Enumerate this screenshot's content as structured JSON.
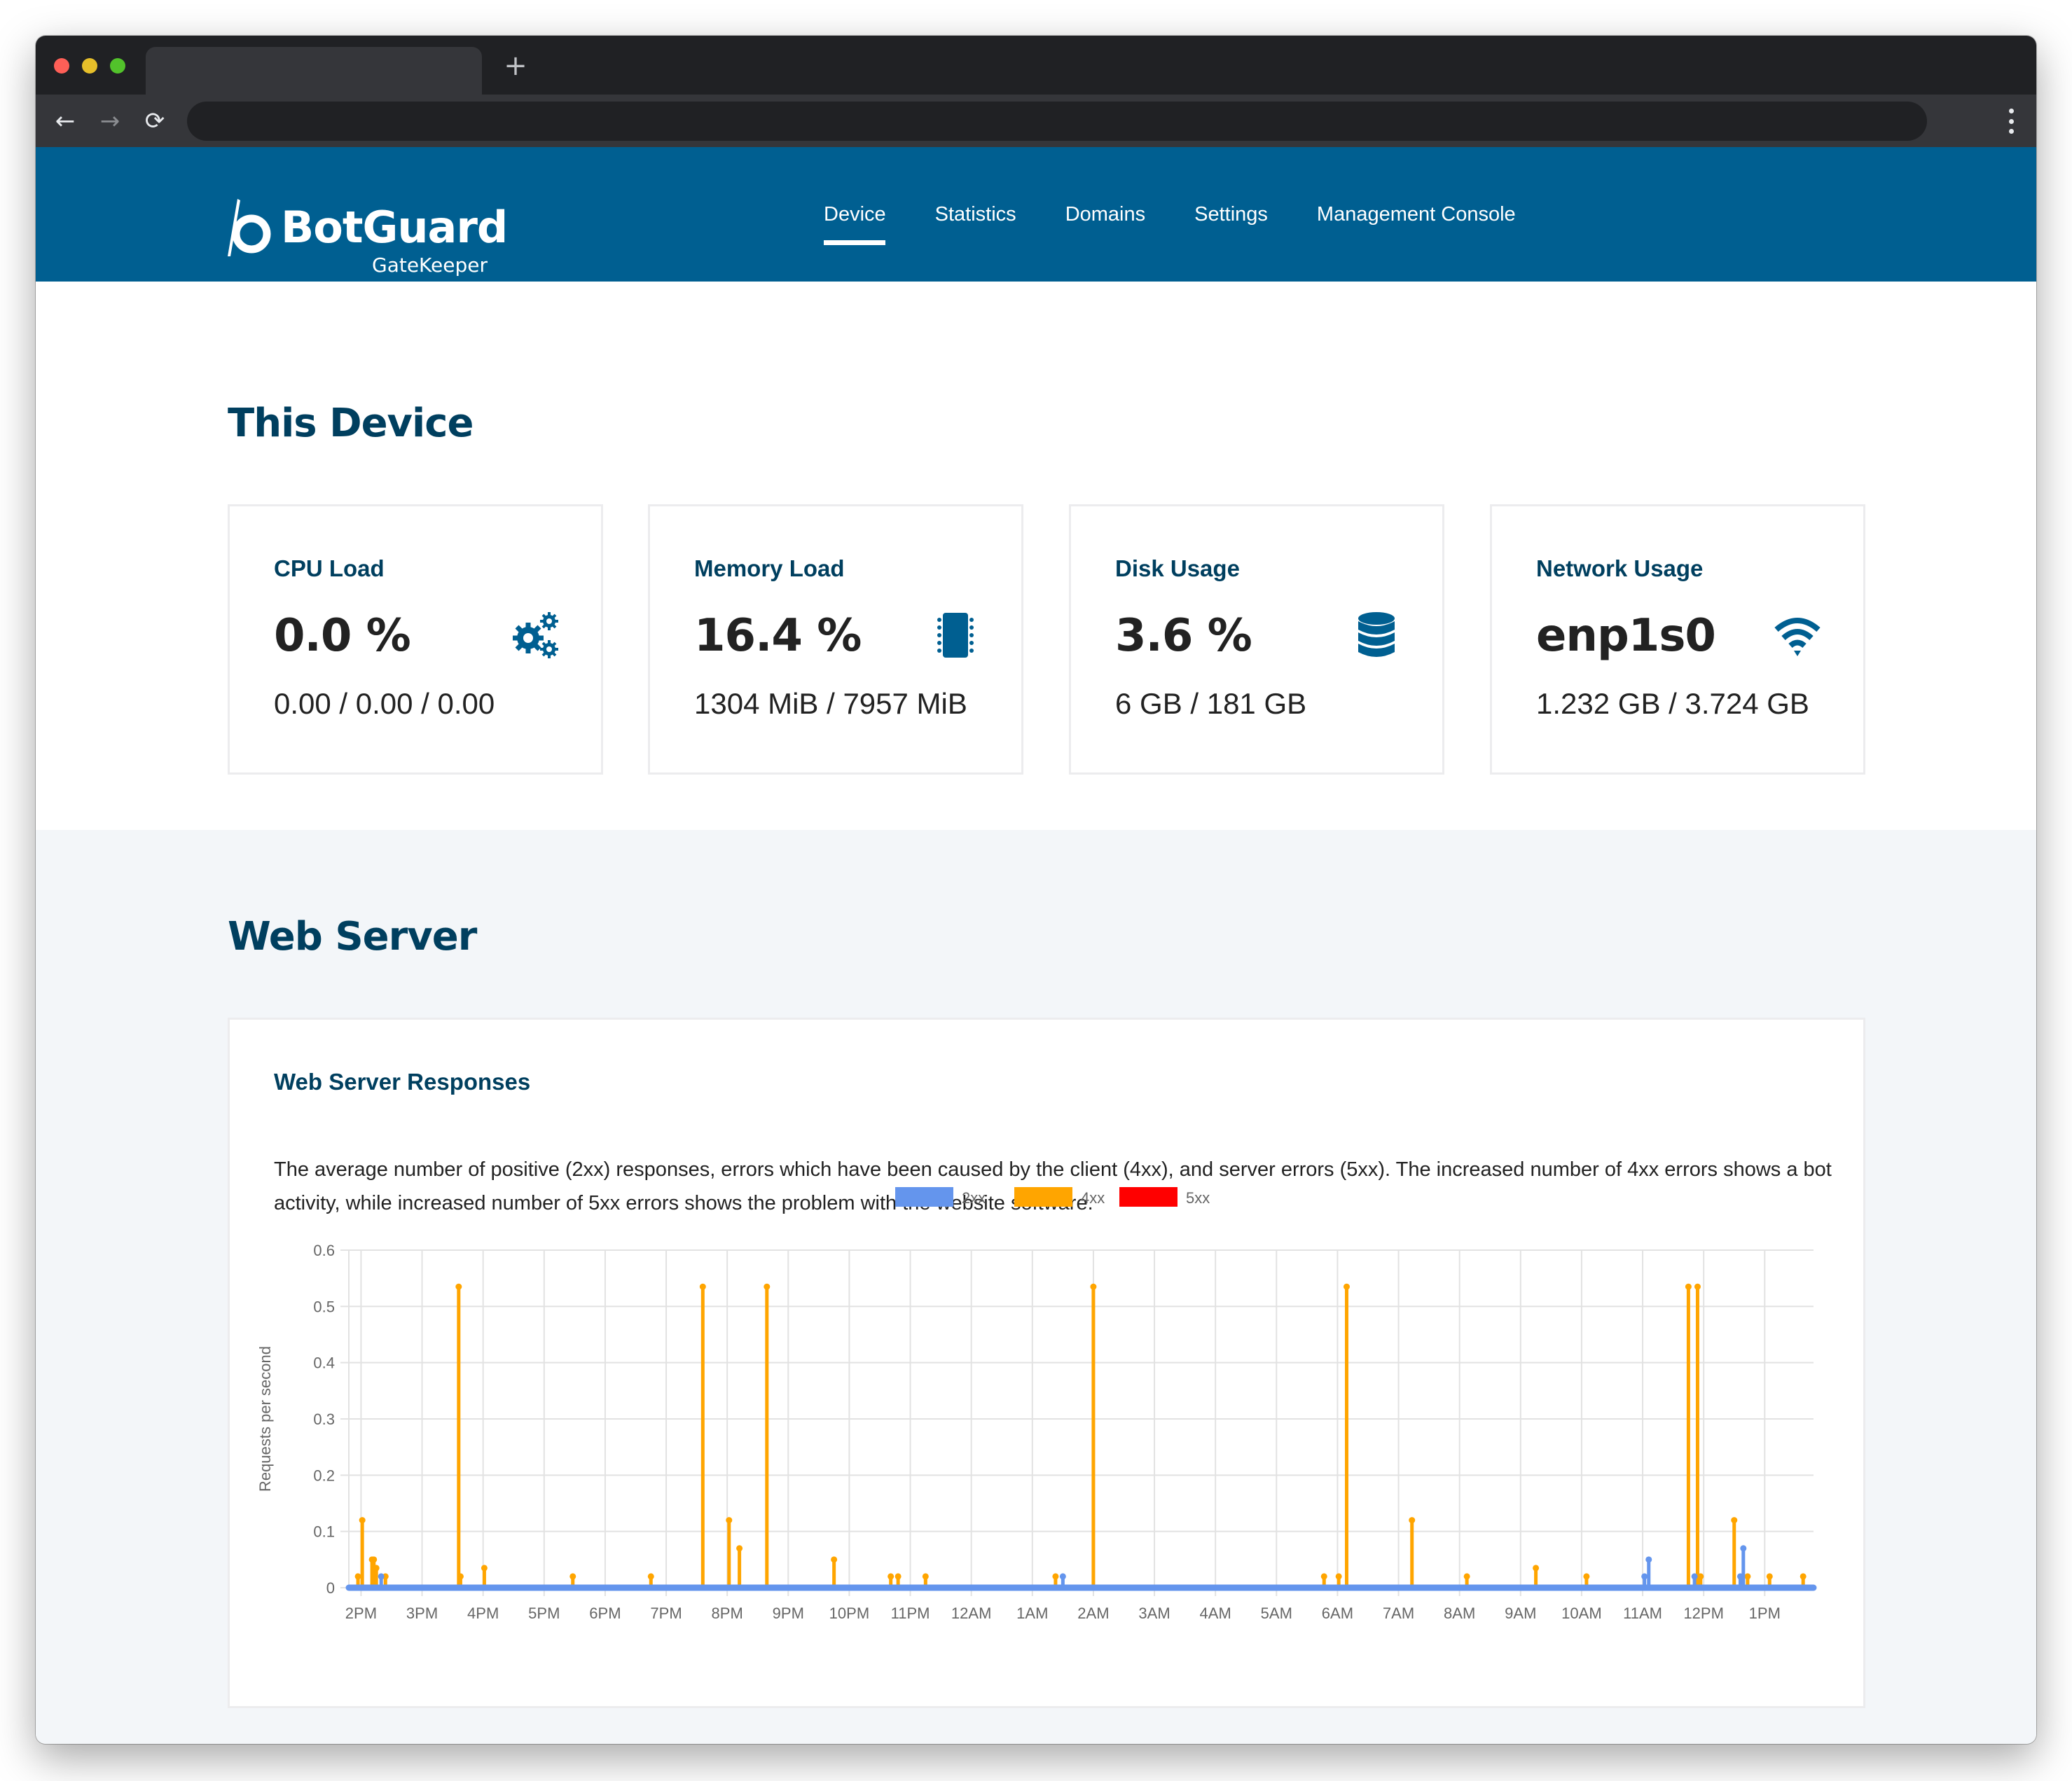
{
  "browser": {
    "new_tab_label": "+",
    "back_icon": "←",
    "forward_icon": "→",
    "reload_icon": "⟳",
    "address": ""
  },
  "header": {
    "brand": "BotGuard",
    "product": "GateKeeper",
    "brand_color": "#005f91",
    "nav": [
      {
        "label": "Device",
        "active": true
      },
      {
        "label": "Statistics",
        "active": false
      },
      {
        "label": "Domains",
        "active": false
      },
      {
        "label": "Settings",
        "active": false
      },
      {
        "label": "Management Console",
        "active": false
      }
    ]
  },
  "device": {
    "title": "This Device",
    "cards": [
      {
        "title": "CPU Load",
        "value": "0.0 %",
        "detail": "0.00 / 0.00 / 0.00",
        "icon": "gears-icon"
      },
      {
        "title": "Memory Load",
        "value": "16.4 %",
        "detail": "1304 MiB / 7957 MiB",
        "icon": "memory-chip-icon"
      },
      {
        "title": "Disk Usage",
        "value": "3.6 %",
        "detail": "6 GB / 181 GB",
        "icon": "database-icon"
      },
      {
        "title": "Network Usage",
        "value": "enp1s0",
        "detail": "1.232 GB / 3.724 GB",
        "icon": "wifi-icon"
      }
    ]
  },
  "web_server": {
    "title": "Web Server",
    "card_title": "Web Server Responses",
    "description": "The average number of positive (2xx) responses, errors which have been caused by the client (4xx), and server errors (5xx). The increased number of 4xx errors shows a bot activity, while increased number of 5xx errors shows the problem with the website software."
  },
  "chart_data": {
    "type": "line",
    "title": "",
    "xlabel": "",
    "ylabel": "Requests per second",
    "ylim": [
      0,
      0.6
    ],
    "yticks": [
      "0",
      "0.1",
      "0.2",
      "0.3",
      "0.4",
      "0.5",
      "0.6"
    ],
    "ytick_values": [
      0,
      0.1,
      0.2,
      0.3,
      0.4,
      0.5,
      0.6
    ],
    "xlim_hours_from_2pm": [
      -0.2,
      23.8
    ],
    "xticks": [
      "2PM",
      "3PM",
      "4PM",
      "5PM",
      "6PM",
      "7PM",
      "8PM",
      "9PM",
      "10PM",
      "11PM",
      "12AM",
      "1AM",
      "2AM",
      "3AM",
      "4AM",
      "5AM",
      "6AM",
      "7AM",
      "8AM",
      "9AM",
      "10AM",
      "11AM",
      "12PM",
      "1PM"
    ],
    "grid": true,
    "legend_position": "top-center",
    "x_unit": "hours since 2PM",
    "series": [
      {
        "name": "2xx",
        "color": "#6495ed",
        "baseline": 0,
        "spikes": [
          [
            0.33,
            0.02
          ],
          [
            11.5,
            0.02
          ],
          [
            21.03,
            0.02
          ],
          [
            21.1,
            0.05
          ],
          [
            21.85,
            0.02
          ],
          [
            22.6,
            0.02
          ],
          [
            22.65,
            0.07
          ]
        ]
      },
      {
        "name": "4xx",
        "color": "#ffa500",
        "baseline": 0,
        "spikes": [
          [
            -0.05,
            0.02
          ],
          [
            0.02,
            0.12
          ],
          [
            0.18,
            0.05
          ],
          [
            0.21,
            0.05
          ],
          [
            0.25,
            0.035
          ],
          [
            0.4,
            0.02
          ],
          [
            1.6,
            0.535
          ],
          [
            1.63,
            0.02
          ],
          [
            2.02,
            0.035
          ],
          [
            3.47,
            0.02
          ],
          [
            4.75,
            0.02
          ],
          [
            5.6,
            0.535
          ],
          [
            6.03,
            0.12
          ],
          [
            6.2,
            0.07
          ],
          [
            6.65,
            0.535
          ],
          [
            7.75,
            0.05
          ],
          [
            8.68,
            0.02
          ],
          [
            8.8,
            0.02
          ],
          [
            9.25,
            0.02
          ],
          [
            11.38,
            0.02
          ],
          [
            12.0,
            0.535
          ],
          [
            15.78,
            0.02
          ],
          [
            16.02,
            0.02
          ],
          [
            16.15,
            0.535
          ],
          [
            17.22,
            0.12
          ],
          [
            18.12,
            0.02
          ],
          [
            19.25,
            0.035
          ],
          [
            20.08,
            0.02
          ],
          [
            21.75,
            0.535
          ],
          [
            21.9,
            0.535
          ],
          [
            21.95,
            0.02
          ],
          [
            22.5,
            0.12
          ],
          [
            22.72,
            0.02
          ],
          [
            23.08,
            0.02
          ],
          [
            23.63,
            0.02
          ]
        ]
      },
      {
        "name": "5xx",
        "color": "#ff0000",
        "baseline": 0,
        "spikes": []
      }
    ]
  }
}
